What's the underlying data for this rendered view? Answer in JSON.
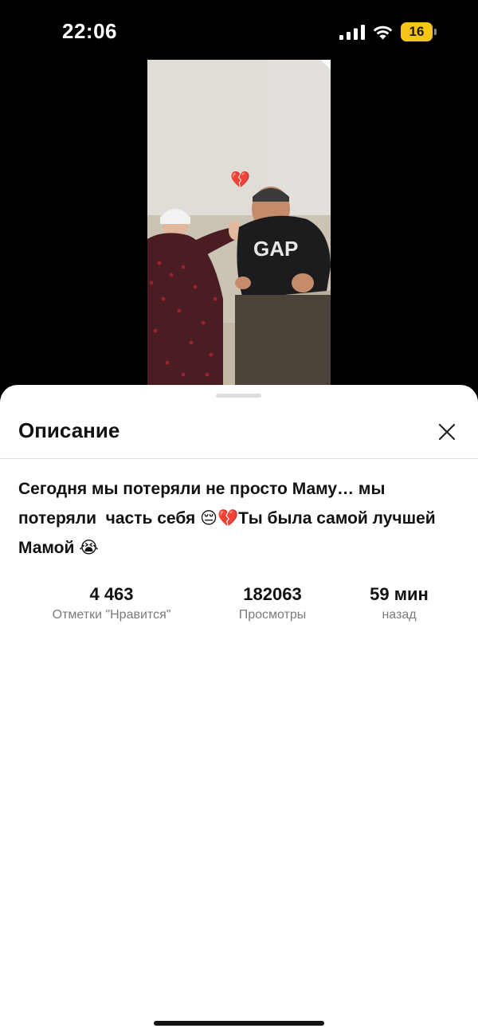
{
  "status_bar": {
    "time": "22:06",
    "battery_level": "16",
    "icons": [
      "cellular-signal-icon",
      "wifi-icon",
      "battery-icon"
    ]
  },
  "video": {
    "overlay_emoji": "💔"
  },
  "sheet": {
    "title": "Описание",
    "close_icon": "close-icon",
    "description": "Сегодня мы потеряли не просто Маму… мы потеряли  часть себя 😔💔Ты была самой лучшей Мамой 😭",
    "stats": {
      "likes": {
        "value": "4 463",
        "label": "Отметки \"Нравится\""
      },
      "views": {
        "value": "182063",
        "label": "Просмотры"
      },
      "time": {
        "value": "59 мин",
        "label": "назад"
      }
    }
  },
  "colors": {
    "background": "#000000",
    "sheet": "#ffffff",
    "text_primary": "#111111",
    "text_secondary": "#7a7a7a",
    "battery": "#f5c518"
  }
}
